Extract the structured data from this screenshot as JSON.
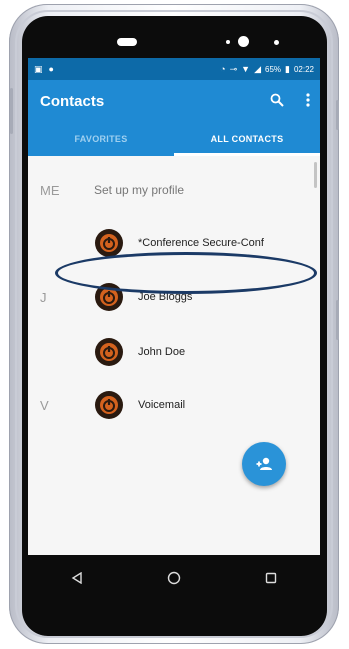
{
  "status_bar": {
    "battery": "65%",
    "time": "02:22"
  },
  "app_bar": {
    "title": "Contacts",
    "search_icon": "search-icon",
    "overflow_icon": "more-vert-icon"
  },
  "tabs": [
    {
      "label": "FAVORITES",
      "active": false
    },
    {
      "label": "ALL CONTACTS",
      "active": true
    }
  ],
  "profile": {
    "letter": "ME",
    "label": "Set up my profile"
  },
  "contacts": [
    {
      "letter": "",
      "name": "*Conference Secure-Conf"
    },
    {
      "letter": "J",
      "name": "Joe Bloggs"
    },
    {
      "letter": "",
      "name": "John Doe"
    },
    {
      "letter": "V",
      "name": "Voicemail"
    }
  ],
  "fab_icon": "add-contact-icon",
  "colors": {
    "status_bar": "#0d6aa8",
    "app_bar": "#1f8ad3",
    "fab": "#2a93d8",
    "highlight": "#1b3a66"
  }
}
